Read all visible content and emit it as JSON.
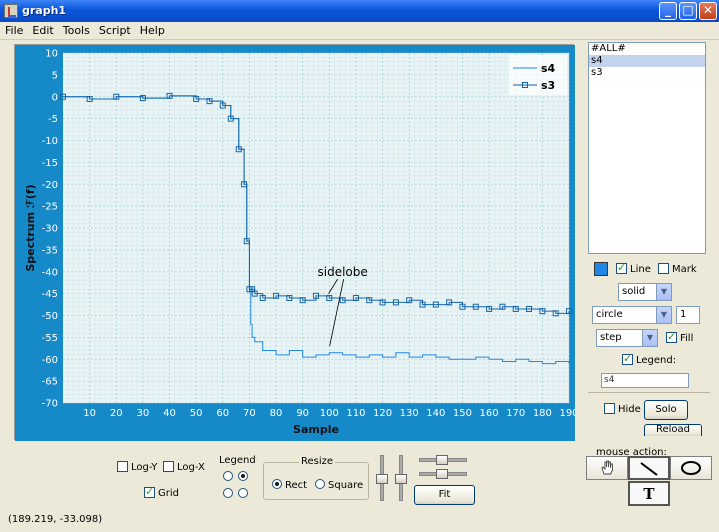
{
  "window": {
    "title": "graph1",
    "buttons": {
      "minimize": "_",
      "maximize": "□",
      "close": "✕"
    }
  },
  "menu": [
    "File",
    "Edit",
    "Tools",
    "Script",
    "Help"
  ],
  "colors": {
    "series_color": "#1f88e5",
    "plot_frame": "#1689c9",
    "plot_bg": "#e8f4f6",
    "grid": "#aacfd6"
  },
  "chart_data": {
    "type": "line",
    "xlabel": "Sample",
    "ylabel": "Spectrum ℱ(f)",
    "xlim": [
      0,
      190
    ],
    "ylim": [
      -70,
      10
    ],
    "x_ticks": [
      10,
      20,
      30,
      40,
      50,
      60,
      70,
      80,
      90,
      100,
      110,
      120,
      130,
      140,
      150,
      160,
      170,
      180,
      190
    ],
    "y_ticks": [
      10,
      5,
      0,
      -5,
      -10,
      -15,
      -20,
      -25,
      -30,
      -35,
      -40,
      -45,
      -50,
      -55,
      -60,
      -65,
      -70
    ],
    "grid": true,
    "legend": "top-right",
    "annotation": {
      "text": "sidelobe",
      "x": 105,
      "y": -41
    },
    "series": [
      {
        "name": "s4",
        "style": "step",
        "marker": "none",
        "x": [
          0,
          10,
          20,
          30,
          40,
          50,
          55,
          60,
          63,
          66,
          68,
          69,
          70,
          70.5,
          71,
          72,
          75,
          80,
          85,
          90,
          95,
          100,
          105,
          110,
          115,
          120,
          125,
          130,
          135,
          140,
          145,
          150,
          155,
          160,
          165,
          170,
          175,
          180,
          185,
          190
        ],
        "y": [
          0,
          -0.5,
          0,
          -0.3,
          0.2,
          -0.5,
          -1,
          -2,
          -5,
          -12,
          -20,
          -33,
          -44,
          -52,
          -55,
          -56,
          -58,
          -59,
          -58,
          -59.5,
          -59,
          -58.5,
          -59,
          -59.5,
          -59,
          -59.5,
          -58.5,
          -59.5,
          -59,
          -59.5,
          -60,
          -60,
          -59.5,
          -60,
          -60.5,
          -60,
          -60.5,
          -61,
          -60.5,
          -61
        ]
      },
      {
        "name": "s3",
        "style": "step",
        "marker": "square",
        "x": [
          0,
          10,
          20,
          30,
          40,
          50,
          55,
          60,
          63,
          66,
          68,
          69,
          70,
          71,
          72,
          75,
          80,
          85,
          90,
          95,
          100,
          105,
          110,
          115,
          120,
          125,
          130,
          135,
          140,
          145,
          150,
          155,
          160,
          165,
          170,
          175,
          180,
          185,
          190
        ],
        "y": [
          0,
          -0.5,
          0,
          -0.3,
          0.2,
          -0.5,
          -1,
          -2,
          -5,
          -12,
          -20,
          -33,
          -44,
          -44,
          -45,
          -46,
          -45.5,
          -46,
          -46.5,
          -45.5,
          -46,
          -46.5,
          -46,
          -46.5,
          -47,
          -47,
          -46.5,
          -47.5,
          -47.5,
          -47,
          -48,
          -48,
          -48.5,
          -48,
          -48.5,
          -48.5,
          -49,
          -49.5,
          -49
        ]
      }
    ]
  },
  "side": {
    "list": [
      "#ALL#",
      "s4",
      "s3"
    ],
    "selected_index": 1,
    "line_label": "Line",
    "line_checked": true,
    "mark_label": "Mark",
    "mark_checked": false,
    "line_style": "solid",
    "marker_shape": "circle",
    "marker_size": "1",
    "draw_mode": "step",
    "fill_label": "Fill",
    "fill_checked": true,
    "legend_label": "Legend:",
    "legend_checked": true,
    "legend_text": "s4",
    "hide_label": "Hide",
    "hide_checked": false,
    "solo_label": "Solo",
    "reload_label": "Reload"
  },
  "bottom": {
    "logy_label": "Log-Y",
    "logx_label": "Log-X",
    "grid_label": "Grid",
    "legend_group": "Legend",
    "resize_group": "Resize",
    "rect_label": "Rect",
    "square_label": "Square",
    "fit_label": "Fit",
    "mouse_action_label": "mouse action:",
    "text_tool": "T"
  },
  "status": "(189.219, -33.098)"
}
